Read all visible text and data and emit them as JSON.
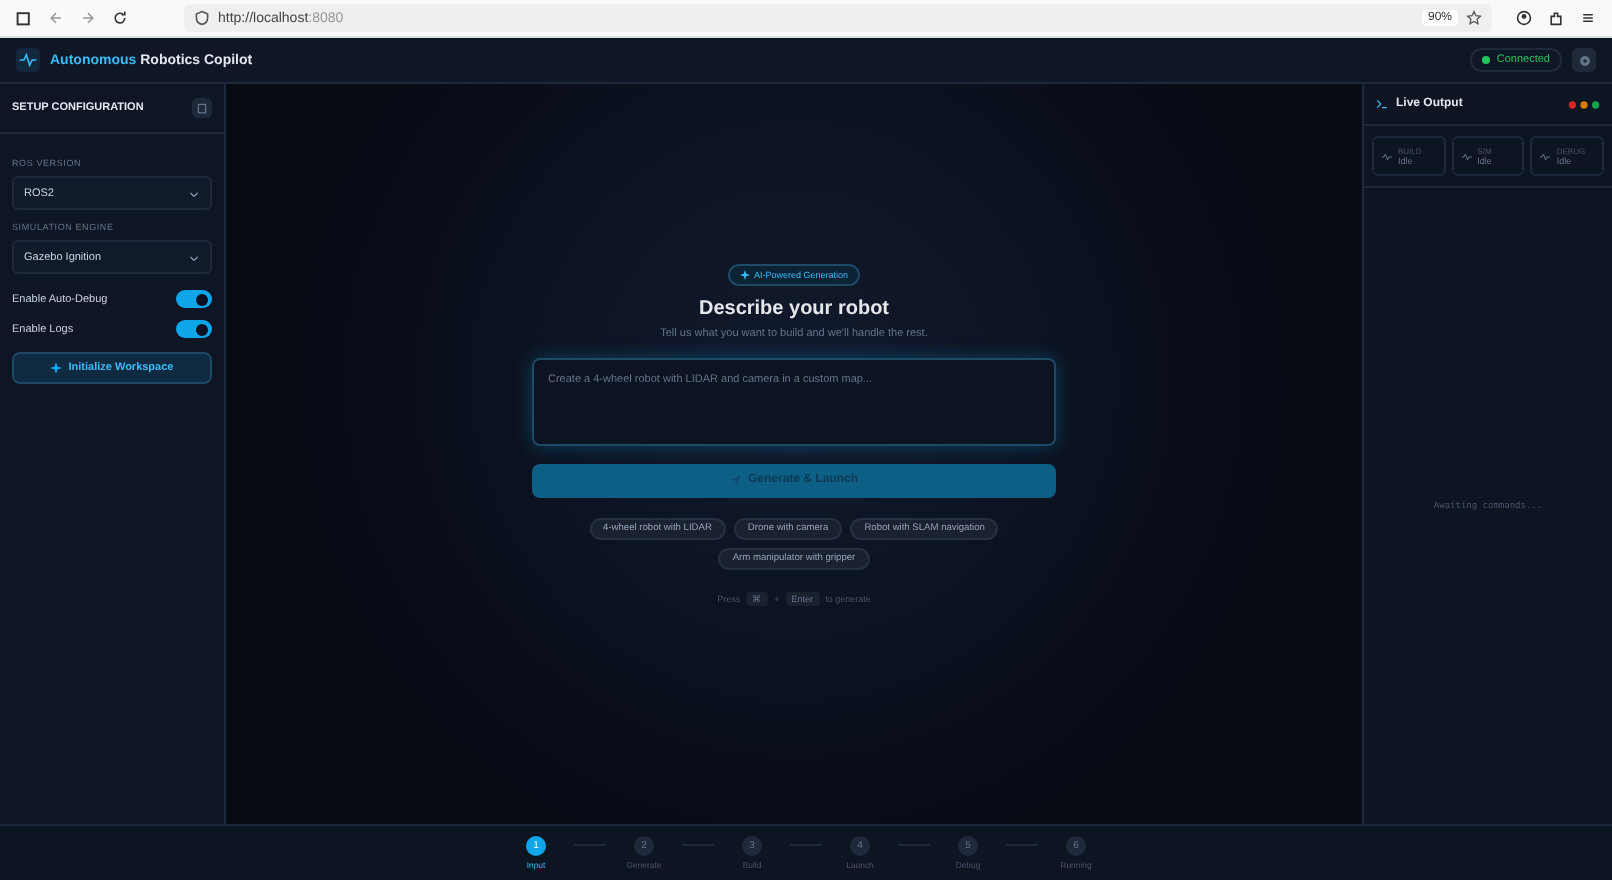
{
  "browser": {
    "url_host": "http://localhost",
    "url_port": ":8080",
    "zoom": "90%"
  },
  "header": {
    "title_accent": "Autonomous",
    "title_rest": "Robotics Copilot",
    "status": "Connected"
  },
  "sidebar": {
    "title": "SETUP CONFIGURATION",
    "selects": [
      {
        "label": "ROS VERSION",
        "value": "ROS2"
      },
      {
        "label": "SIMULATION ENGINE",
        "value": "Gazebo Ignition"
      }
    ],
    "toggles": [
      {
        "label": "Enable Auto-Debug",
        "on": true
      },
      {
        "label": "Enable Logs",
        "on": true
      }
    ],
    "button": "Initialize Workspace"
  },
  "main": {
    "badge": "AI-Powered Generation",
    "heading": "Describe your robot",
    "subtitle": "Tell us what you want to build and we'll handle the rest.",
    "placeholder": "Create a 4-wheel robot with LIDAR and camera in a custom map...",
    "button": "Generate & Launch",
    "suggestions": [
      "4-wheel robot with LIDAR",
      "Drone with camera",
      "Robot with SLAM navigation",
      "Arm manipulator with gripper"
    ],
    "hint": {
      "before": "Press",
      "key1": "⌘",
      "plus": "+",
      "key2": "Enter",
      "after": "to generate"
    }
  },
  "output": {
    "title": "Live Output",
    "cards": [
      {
        "label": "BUILD",
        "status": "Idle"
      },
      {
        "label": "SIM",
        "status": "Idle"
      },
      {
        "label": "DEBUG",
        "status": "Idle"
      }
    ],
    "empty": "Awaiting commands..."
  },
  "steps": [
    {
      "number": "1",
      "label": "Input",
      "selected": true
    },
    {
      "number": "2",
      "label": "Generate",
      "selected": false
    },
    {
      "number": "3",
      "label": "Build",
      "selected": false
    },
    {
      "number": "4",
      "label": "Launch",
      "selected": false
    },
    {
      "number": "5",
      "label": "Debug",
      "selected": false
    },
    {
      "number": "6",
      "label": "Running",
      "selected": false
    }
  ]
}
